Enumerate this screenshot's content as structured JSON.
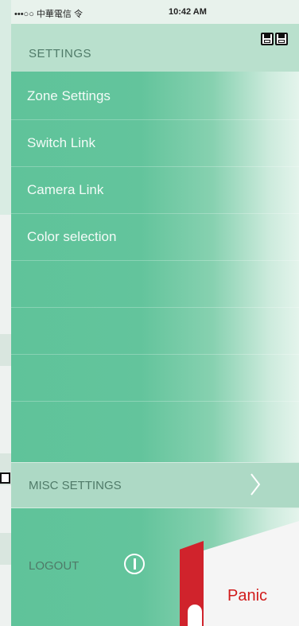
{
  "status_bar": {
    "left": "•••○○ 中華電信 令",
    "time": "10:42 AM"
  },
  "header": {
    "title": "SETTINGS"
  },
  "menu": {
    "items": [
      "Zone Settings",
      "Switch Link",
      "Camera Link",
      "Color selection"
    ]
  },
  "misc": {
    "label": "MISC SETTINGS"
  },
  "logout": {
    "label": "LOGOUT"
  },
  "panic": {
    "label": "Panic"
  },
  "colors": {
    "accent": "#5fc39a",
    "panic": "#d11b1b"
  }
}
